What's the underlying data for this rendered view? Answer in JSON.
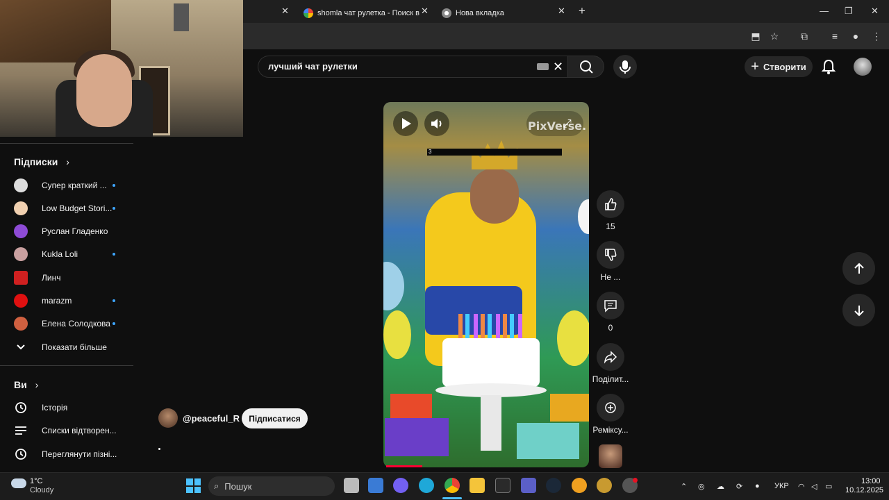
{
  "browser": {
    "tabs": [
      {
        "title": "shomla чат рулетка - Поиск в"
      },
      {
        "title": "Нова вкладка"
      }
    ],
    "new_tab_symbol": "+",
    "close_symbol": "✕",
    "window_controls": {
      "minimize": "—",
      "restore": "❐",
      "close": "✕"
    }
  },
  "header": {
    "search_query": "лучший чат рулетки",
    "create_label": "Створити"
  },
  "sidebar": {
    "subscriptions_title": "Підписки",
    "subscriptions": [
      {
        "label": "Супер краткий ...",
        "new": true,
        "color": "#dddddd"
      },
      {
        "label": "Low Budget Stori...",
        "new": true,
        "color": "#f0d0b0"
      },
      {
        "label": "Руслан Гладенко",
        "new": false,
        "color": "#8e4bd6"
      },
      {
        "label": "Kukla Loli",
        "new": true,
        "color": "#c9a0a0"
      },
      {
        "label": "Линч",
        "new": false,
        "color": "#d02020"
      },
      {
        "label": "marazm",
        "new": true,
        "color": "#e01010"
      },
      {
        "label": "Елена Солодкова",
        "new": true,
        "color": "#d06040"
      }
    ],
    "show_more": "Показати більше",
    "you_title": "Ви",
    "you_items": [
      {
        "label": "Історія"
      },
      {
        "label": "Списки відтворен..."
      },
      {
        "label": "Переглянути пізні..."
      }
    ]
  },
  "video": {
    "watermark": "PixVerse.",
    "caption": "3",
    "progress_fraction": 0.18
  },
  "actions": {
    "likes": "15",
    "dislike_label": "Не ...",
    "comments": "0",
    "share_label": "Поділит...",
    "remix_label": "Реміксу..."
  },
  "channel": {
    "handle": "@peaceful_R",
    "subscribe_label": "Підписатися"
  },
  "taskbar": {
    "weather_temp": "1°C",
    "weather_desc": "Cloudy",
    "search_label": "Пошук",
    "language": "УКР",
    "time": "13:00",
    "date": "10.12.2025"
  },
  "colors": {
    "accent_red": "#ff0033",
    "new_dot": "#3ea6ff"
  }
}
